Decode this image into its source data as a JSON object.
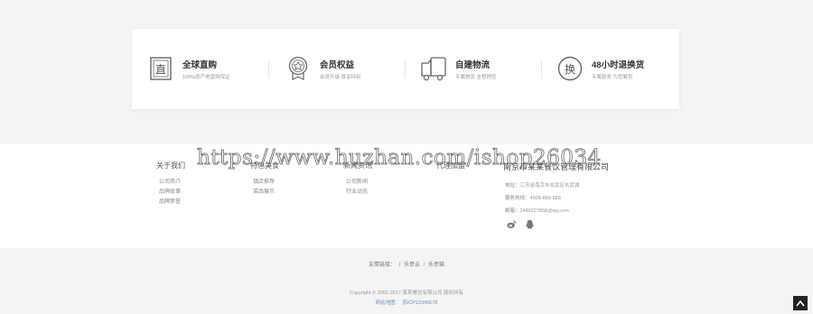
{
  "features": [
    {
      "icon": "zhi-stamp-icon",
      "title": "全球直购",
      "subtitle": "100%原产地直购保证"
    },
    {
      "icon": "medal-icon",
      "title": "会员权益",
      "subtitle": "会员升级 尊享特权"
    },
    {
      "icon": "truck-icon",
      "title": "自建物流",
      "subtitle": "专属物流 全程把控"
    },
    {
      "icon": "exchange-icon",
      "title": "48小时退换货",
      "subtitle": "专属服务 为您解答"
    }
  ],
  "footer": {
    "columns": [
      {
        "heading": "关于我们",
        "items": [
          "公司简介",
          "品牌故事",
          "品牌荣誉"
        ]
      },
      {
        "heading": "特色美食",
        "items": [
          "镇店推荐",
          "菜品展示"
        ]
      },
      {
        "heading": "新闻资讯",
        "items": [
          "公司新闻",
          "行业动态"
        ]
      },
      {
        "heading": "代理加盟",
        "items": []
      }
    ],
    "company": {
      "name": "南京市某某餐饮管理有限公司",
      "address_label": "地址：",
      "address": "江苏省南京市玄武区玄武湖",
      "phone_label": "服务热线：",
      "phone": "4008-888-888",
      "email_label": "邮箱：",
      "email": "2446227858@qq.com"
    },
    "social": [
      "weibo-icon",
      "qq-icon"
    ]
  },
  "watermark": "https://www.huzhan.com/ishop26034",
  "friend_links": {
    "label": "友情链接：",
    "items": [
      "/",
      "乐意云",
      "/",
      "乐意猫"
    ]
  },
  "copyright": "Copyright © 2002-2017 某某餐饮有限公司 版权所有",
  "bottom_links": [
    "网站地图",
    "苏ICP12345678"
  ],
  "colors": {
    "accent_link": "#6a8fc0",
    "background": "#f4f4f4"
  }
}
